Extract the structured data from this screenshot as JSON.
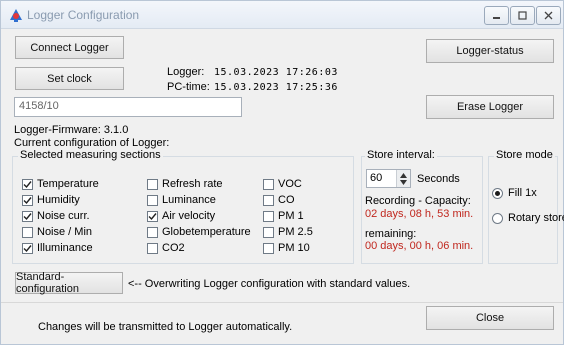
{
  "window": {
    "title": "Logger Configuration"
  },
  "buttons": {
    "connect": "Connect Logger",
    "set_clock": "Set clock",
    "logger_status": "Logger-status",
    "erase": "Erase Logger",
    "standard_config": "Standard-configuration",
    "close": "Close"
  },
  "clock": {
    "logger_label": "Logger:",
    "logger_value": "15.03.2023 17:26:03",
    "pc_label": "PC-time:",
    "pc_value": "15.03.2023 17:25:36"
  },
  "logger_id": "4158/10",
  "firmware": "Logger-Firmware: 3.1.0",
  "current_config_label": "Current configuration of Logger:",
  "sections": {
    "title": "Selected measuring sections",
    "items": [
      {
        "label": "Temperature",
        "checked": true
      },
      {
        "label": "Humidity",
        "checked": true
      },
      {
        "label": "Noise curr.",
        "checked": true
      },
      {
        "label": "Noise / Min",
        "checked": false
      },
      {
        "label": "Illuminance",
        "checked": true
      },
      {
        "label": "Refresh rate",
        "checked": false
      },
      {
        "label": "Luminance",
        "checked": false
      },
      {
        "label": "Air velocity",
        "checked": true
      },
      {
        "label": "Globetemperature",
        "checked": false
      },
      {
        "label": "CO2",
        "checked": false
      },
      {
        "label": "VOC",
        "checked": false
      },
      {
        "label": "CO",
        "checked": false
      },
      {
        "label": "PM 1",
        "checked": false
      },
      {
        "label": "PM 2.5",
        "checked": false
      },
      {
        "label": "PM 10",
        "checked": false
      }
    ]
  },
  "store_interval": {
    "title": "Store interval:",
    "value": "60",
    "unit": "Seconds",
    "capacity_label": "Recording - Capacity:",
    "capacity_value": "02 days, 08 h, 53 min.",
    "remaining_label": "remaining:",
    "remaining_value": "00 days, 00 h, 06 min."
  },
  "store_mode": {
    "title": "Store mode",
    "options": [
      {
        "label": "Fill 1x",
        "selected": true
      },
      {
        "label": "Rotary store",
        "selected": false
      }
    ]
  },
  "standard_note": "<-- Overwriting Logger configuration with standard values.",
  "footer_note": "Changes will be transmitted to Logger automatically.",
  "colors": {
    "accent_red": "#c0271e",
    "title_text": "#8a9bb0"
  }
}
